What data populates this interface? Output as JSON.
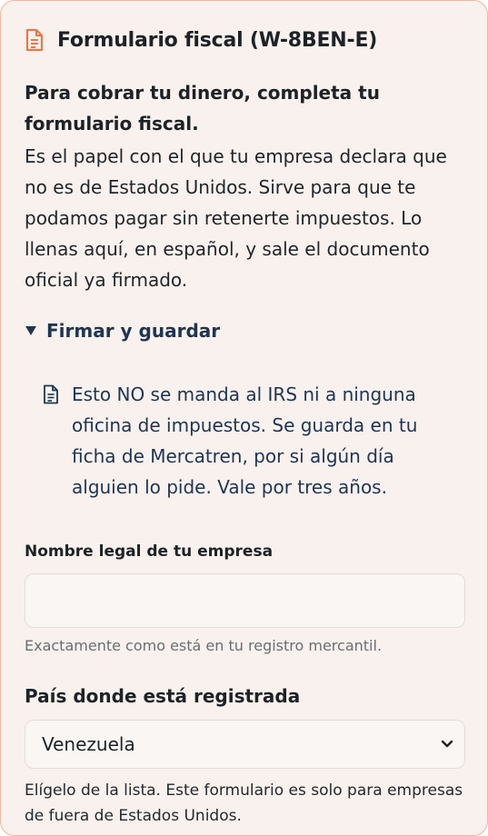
{
  "form": {
    "title": "Formulario fiscal (W-8BEN-E)",
    "title_icon": "document-icon",
    "lead": "Para cobrar tu dinero, completa tu formulario fiscal.",
    "description": "Es el papel con el que tu empresa declara que no es de Estados Unidos. Sirve para que te podamos pagar sin retenerte impuestos. Lo llenas aquí, en español, y sale el documento oficial ya firmado.",
    "section": {
      "label": "Firmar y guardar",
      "expanded": true,
      "note_icon": "document-icon",
      "note": "Esto NO se manda al IRS ni a ninguna oficina de impuestos. Se guarda en tu ficha de Mercatren, por si algún día alguien lo pide. Vale por tres años."
    },
    "fields": {
      "company_name": {
        "label": "Nombre legal de tu empresa",
        "value": "",
        "hint": "Exactamente como está en tu registro mercantil."
      },
      "country": {
        "label": "País donde está registrada",
        "selected": "Venezuela",
        "hint": "Elígelo de la lista. Este formulario es solo para empresas de fuera de Estados Unidos."
      }
    }
  },
  "colors": {
    "accent": "#e8774a",
    "card_background": "#f8f1ee",
    "card_border": "#f1b79b",
    "link_navy": "#1f3550"
  }
}
